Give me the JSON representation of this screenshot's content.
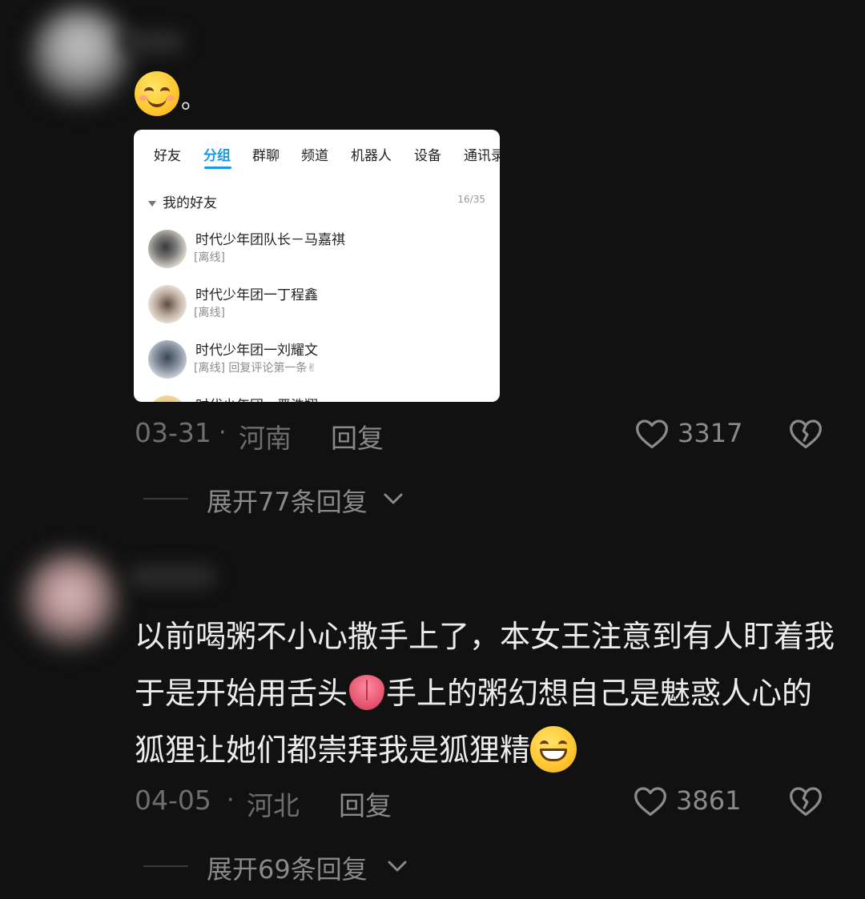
{
  "comments": [
    {
      "text_suffix": "。",
      "emoji": "smiling-blush-emoji",
      "image": {
        "tabs": [
          "好友",
          "分组",
          "群聊",
          "频道",
          "机器人",
          "设备",
          "通讯录"
        ],
        "active_tab": "分组",
        "group": {
          "name": "我的好友",
          "count": "16/35"
        },
        "friends": [
          {
            "name": "时代少年团队长－马嘉祺",
            "status": "[离线]"
          },
          {
            "name": "时代少年团一丁程鑫",
            "status": "[离线]"
          },
          {
            "name": "时代少年团一刘耀文",
            "status": "[离线] 回复评论第一条✌"
          },
          {
            "name": "时代少年团一严浩翔",
            "status": ""
          }
        ]
      },
      "date": "03-31",
      "location": "河南",
      "reply_label": "回复",
      "likes": "3317",
      "expand_label": "展开77条回复"
    },
    {
      "text_part1": "以前喝粥不小心撒手上了，本女王注意到有人盯着我于是开始用舌头",
      "text_part2": "手上的粥幻想自己是魅惑人心的狐狸让她们都崇拜我是狐狸精",
      "date": "04-05",
      "location": "河北",
      "reply_label": "回复",
      "likes": "3861",
      "expand_label": "展开69条回复"
    }
  ],
  "separator": "·"
}
